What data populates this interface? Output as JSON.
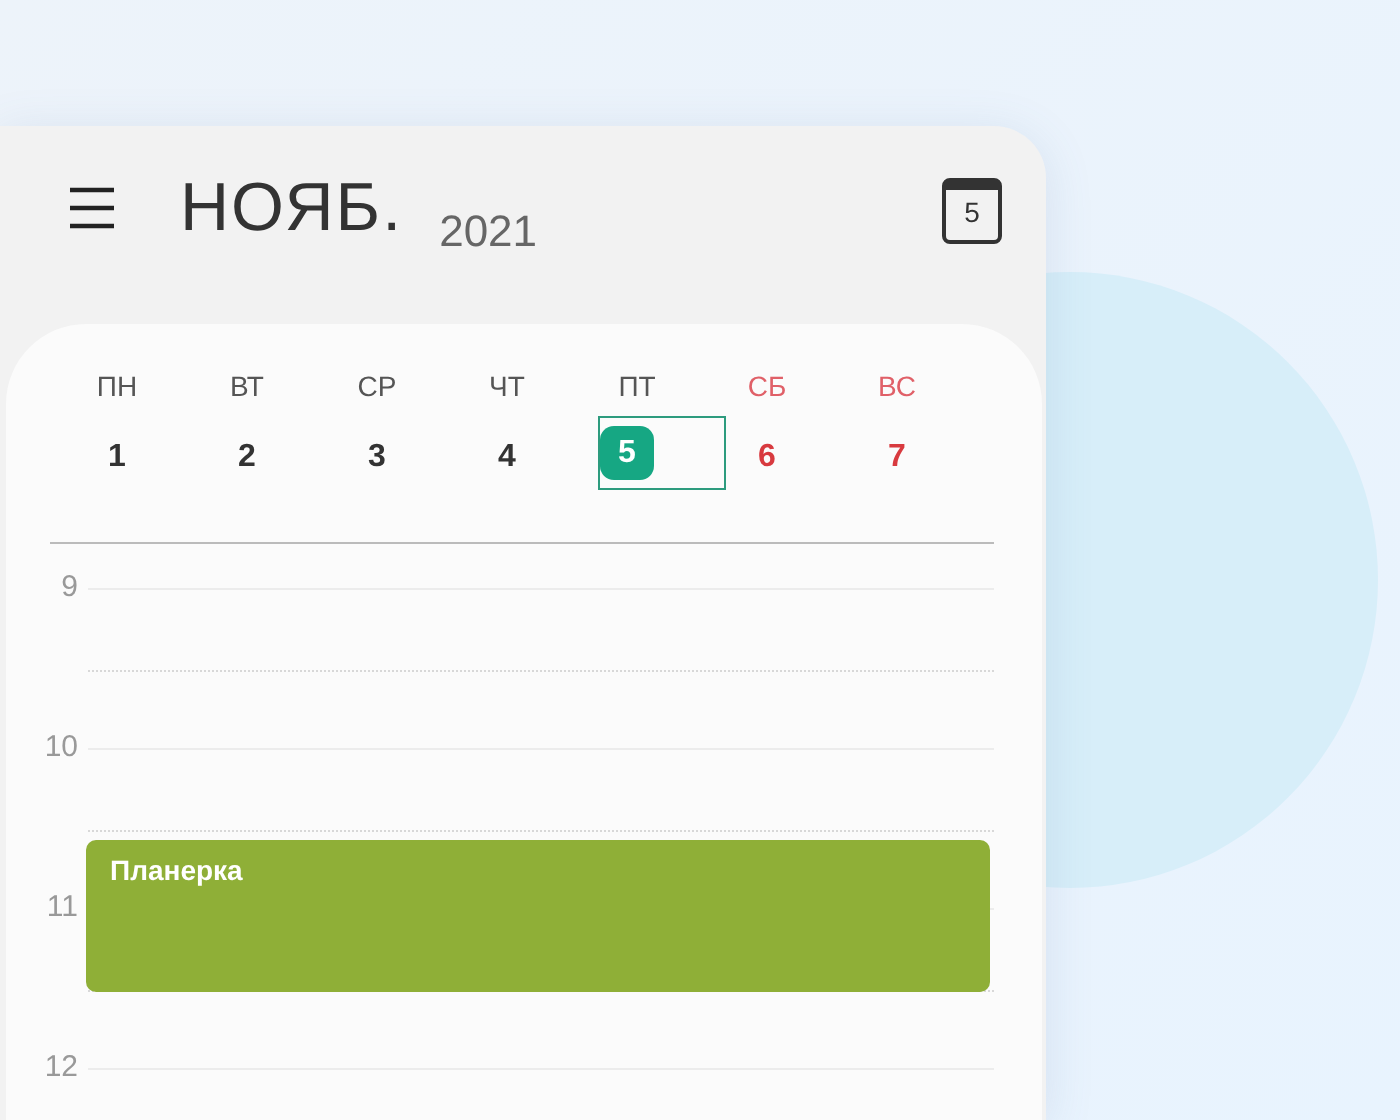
{
  "header": {
    "month": "НОЯБ.",
    "year": "2021",
    "today_icon": "5"
  },
  "days": [
    {
      "weekday": "ПН",
      "date": "1",
      "weekend": false,
      "selected": false
    },
    {
      "weekday": "ВТ",
      "date": "2",
      "weekend": false,
      "selected": false
    },
    {
      "weekday": "СР",
      "date": "3",
      "weekend": false,
      "selected": false
    },
    {
      "weekday": "ЧТ",
      "date": "4",
      "weekend": false,
      "selected": false
    },
    {
      "weekday": "ПТ",
      "date": "5",
      "weekend": false,
      "selected": true
    },
    {
      "weekday": "СБ",
      "date": "6",
      "weekend": true,
      "selected": false
    },
    {
      "weekday": "ВС",
      "date": "7",
      "weekend": true,
      "selected": false
    }
  ],
  "hours": [
    "9",
    "10",
    "11",
    "12"
  ],
  "events": [
    {
      "title": "Планерка",
      "color": "#8faf37"
    }
  ]
}
